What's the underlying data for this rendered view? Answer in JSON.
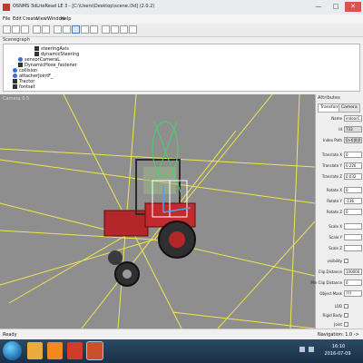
{
  "window": {
    "title": "OSNMS 3dLiteRead LE 3 - [C:\\Users\\Desktop\\scene.i3d] (2.0.2)",
    "btn_min": "—",
    "btn_max": "□",
    "btn_close": "✕"
  },
  "menu": [
    "File",
    "Edit",
    "Create",
    "View",
    "Window",
    "Help"
  ],
  "scenegraph": {
    "label": "Scenegraph",
    "items": [
      "steeringAxis",
      "dynamicSteering",
      "sensorCameraL",
      "DynamicHose_fastener",
      "collision",
      "attacherJointF_",
      "Tractor",
      "fontset"
    ]
  },
  "viewport": {
    "caption": "Camera 0.5"
  },
  "attributes": {
    "header": "Attributes",
    "tabs": [
      "Transform",
      "Camera"
    ],
    "rows": [
      {
        "label": "Name",
        "value": "indoorC..."
      },
      {
        "label": "Id",
        "value": "733"
      },
      {
        "label": "Index Path",
        "value": "0>0|0|0"
      },
      {
        "label": "Translate X",
        "value": "0"
      },
      {
        "label": "Translate Y",
        "value": "0.226"
      },
      {
        "label": "Translate Z",
        "value": "0.032"
      },
      {
        "label": "Rotate X",
        "value": "0"
      },
      {
        "label": "Rotate Y",
        "value": "-136"
      },
      {
        "label": "Rotate Z",
        "value": "0"
      },
      {
        "label": "Scale X",
        "value": ""
      },
      {
        "label": "Scale Y",
        "value": ""
      },
      {
        "label": "Scale Z",
        "value": ""
      },
      {
        "label": "visibility",
        "value": ""
      },
      {
        "label": "Clip Distance",
        "value": "100000"
      },
      {
        "label": "Min Clip Distance",
        "value": "0"
      },
      {
        "label": "Object Mask",
        "value": "???"
      },
      {
        "label": "LOD",
        "value": ""
      },
      {
        "label": "Rigid Body",
        "value": ""
      },
      {
        "label": "Joint",
        "value": ""
      }
    ]
  },
  "status": {
    "left": "Ready",
    "right": "Navigation: 1.0 ->"
  },
  "taskbar": {
    "time": "16:10",
    "date": "2016-07-09"
  }
}
